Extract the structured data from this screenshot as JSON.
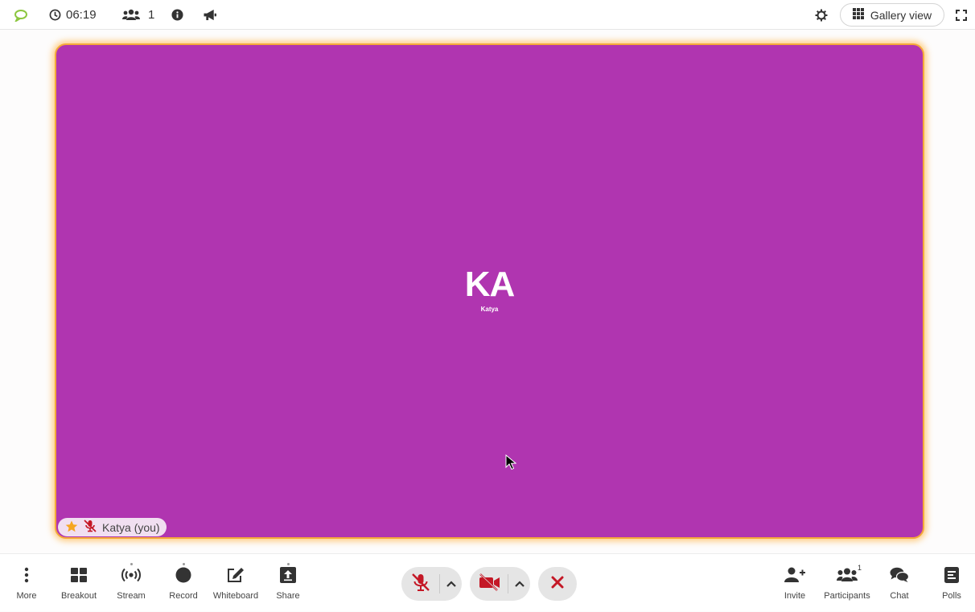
{
  "topbar": {
    "timer": "06:19",
    "participant_count": "1",
    "gallery_view_label": "Gallery view"
  },
  "stage": {
    "initials": "KA",
    "avatar_name": "Katya",
    "name_tag": "Katya (you)",
    "background_color": "#b035b0",
    "active_speaker_border": "#f4a93a"
  },
  "toolbar": {
    "more": "More",
    "breakout": "Breakout",
    "stream": "Stream",
    "record": "Record",
    "whiteboard": "Whiteboard",
    "share": "Share",
    "invite": "Invite",
    "participants": "Participants",
    "participants_badge": "1",
    "chat": "Chat",
    "polls": "Polls"
  },
  "colors": {
    "muted_red": "#c41826",
    "logo_green": "#8cc63f"
  },
  "icons": [
    "logo-icon",
    "clock-icon",
    "users-icon",
    "info-icon",
    "megaphone-icon",
    "settings-icon",
    "grid-icon",
    "fullscreen-icon",
    "star-icon",
    "mic-muted-icon",
    "camera-off-icon",
    "leave-icon"
  ]
}
